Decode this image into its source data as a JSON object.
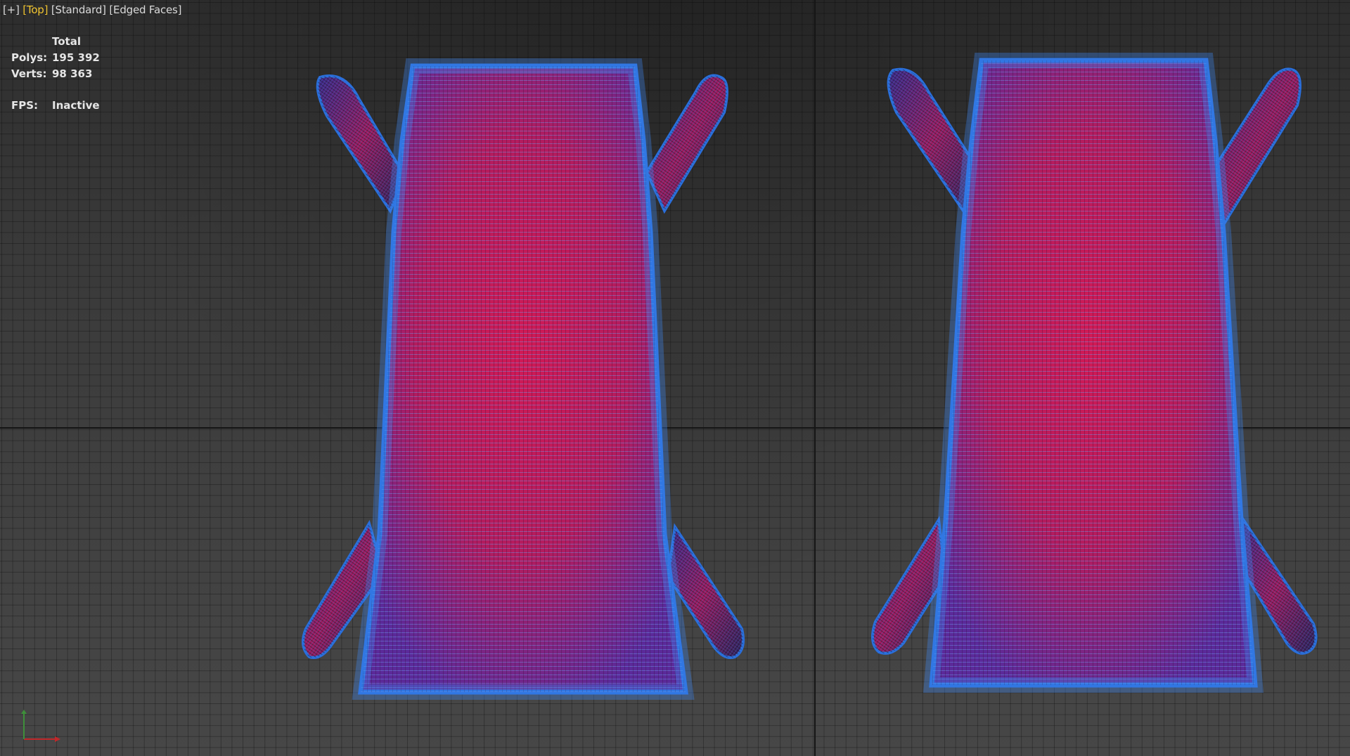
{
  "viewport_labels": {
    "plus": "[+]",
    "view": "[Top]",
    "shading": "[Standard]",
    "display": "[Edged Faces]"
  },
  "stats": {
    "header": "Total",
    "polys_label": "Polys:",
    "polys_value": "195 392",
    "verts_label": "Verts:",
    "verts_value": "98 363",
    "fps_label": "FPS:",
    "fps_value": "Inactive"
  },
  "colors": {
    "active_label": "#f0c430",
    "mesh_edge": "#2a6fdc",
    "mesh_face": "#c4195a",
    "grid_axis": "#151515"
  },
  "icons": {
    "axis": "axis-tripod-icon"
  }
}
